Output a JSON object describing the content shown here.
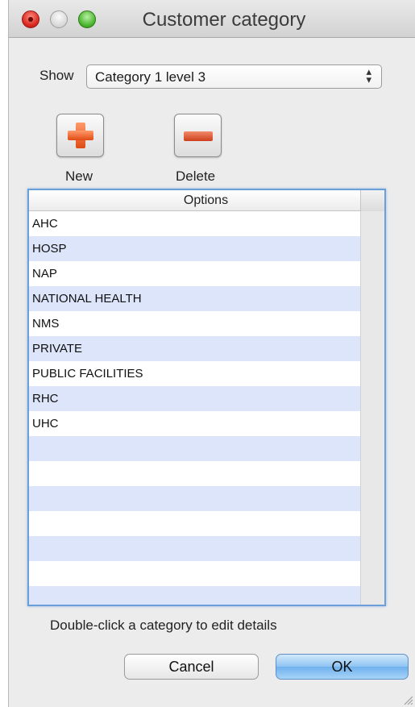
{
  "window": {
    "title": "Customer category"
  },
  "show": {
    "label": "Show",
    "selected": "Category 1 level 3",
    "arrows_icon": "updown-arrows-icon"
  },
  "toolbar": {
    "new_label": "New",
    "delete_label": "Delete",
    "new_icon": "plus-icon",
    "delete_icon": "minus-icon",
    "accent": "#e2541c"
  },
  "table": {
    "header": "Options",
    "rows": [
      "AHC",
      "HOSP",
      "NAP",
      "NATIONAL HEALTH",
      "NMS",
      "PRIVATE",
      "PUBLIC FACILITIES",
      "RHC",
      "UHC",
      "",
      "",
      "",
      "",
      "",
      "",
      ""
    ],
    "stripe_color": "#dde5fb"
  },
  "hint": "Double-click a category to edit details",
  "buttons": {
    "cancel": "Cancel",
    "ok": "OK"
  }
}
